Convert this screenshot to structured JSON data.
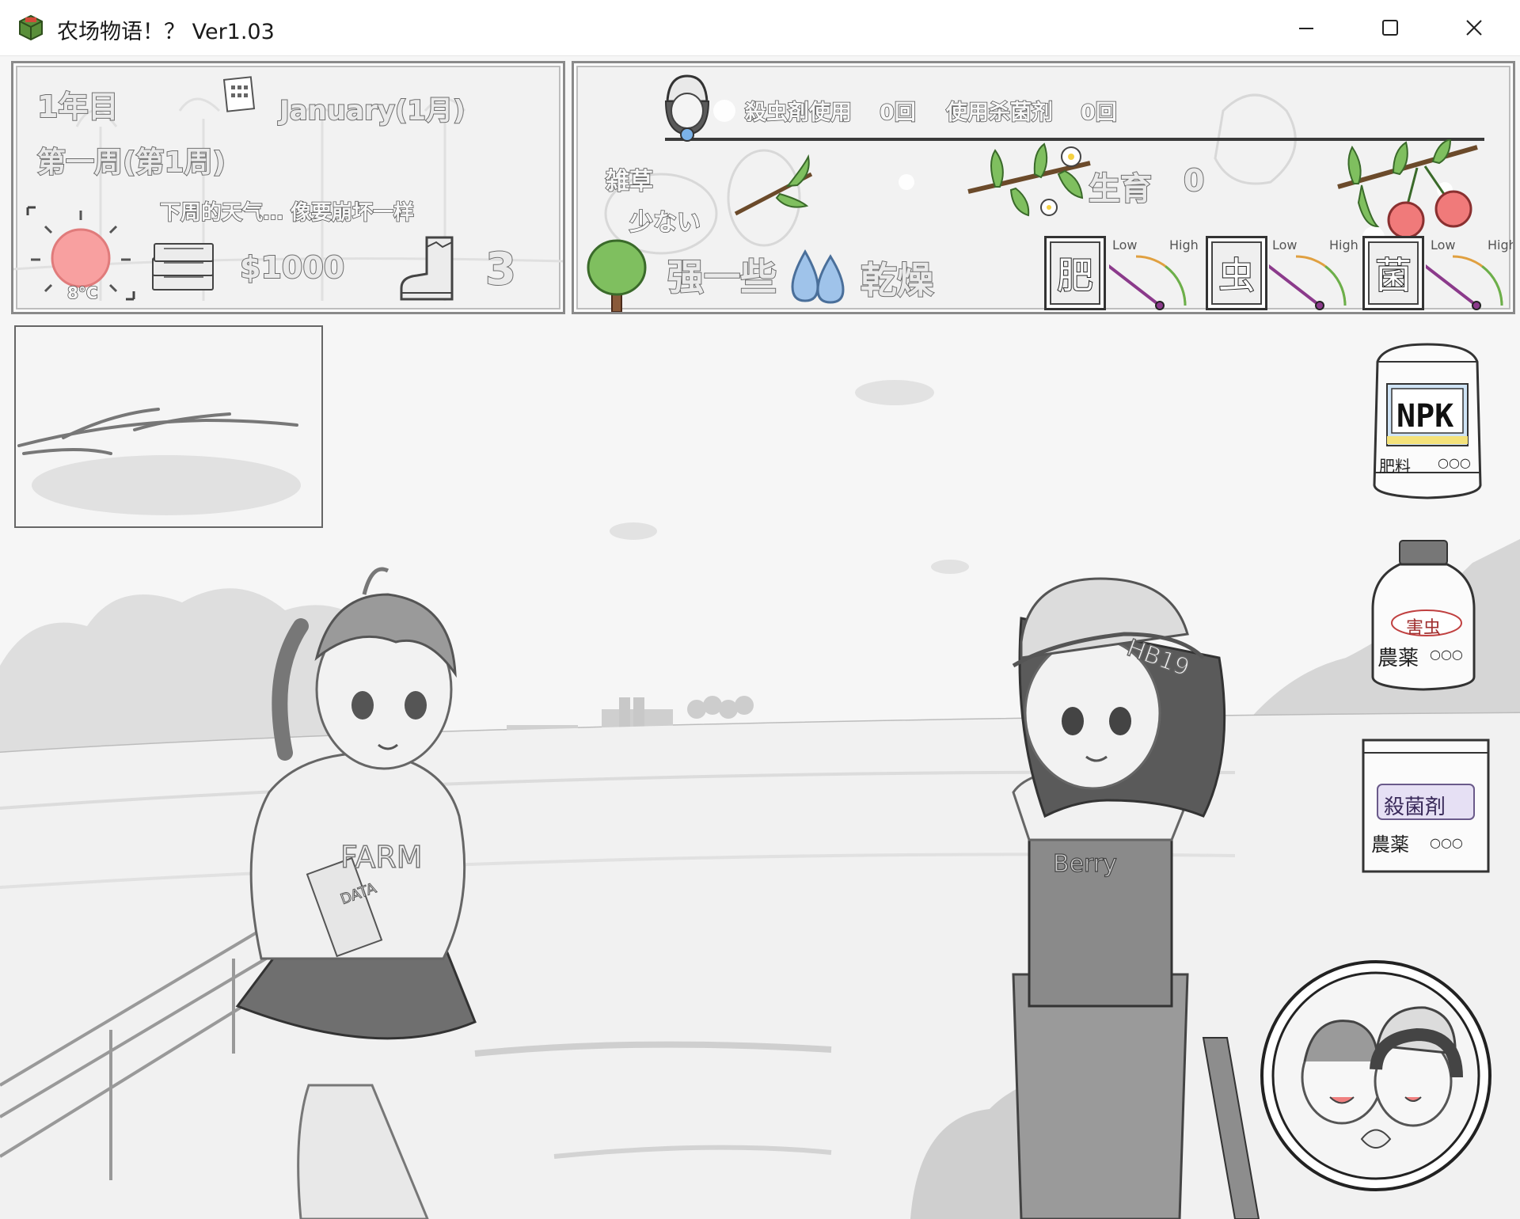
{
  "window": {
    "title": "农场物语！？ Ver1.03",
    "controls": [
      "minimize",
      "maximize",
      "close"
    ]
  },
  "calendar": {
    "year": "1年目",
    "month": "January(1月)",
    "week": "第一周(第1周)",
    "next_week_weather": "下周的天气… 像要崩坏一样",
    "temperature": "8°C",
    "money": "$1000",
    "stamina": "3"
  },
  "crop": {
    "pesticide_used_label": "殺虫剤使用",
    "pesticide_used_value": "0回",
    "fungicide_used_label": "使用杀菌剂",
    "fungicide_used_value": "0回",
    "weed_label": "雑草",
    "weed_value": "少ない",
    "growth_label": "生育",
    "growth_value": "0",
    "tree_strength": "强一些",
    "moisture": "乾燥",
    "gauges": [
      {
        "label": "肥",
        "low": "Low",
        "high": "High",
        "level": 0.15
      },
      {
        "label": "虫",
        "low": "Low",
        "high": "High",
        "level": 0.15
      },
      {
        "label": "菌",
        "low": "Low",
        "high": "High",
        "level": 0.15
      }
    ]
  },
  "items": {
    "fertilizer": {
      "brand": "NPK",
      "label": "肥料",
      "dots": "○○○"
    },
    "pesticide": {
      "tag": "害虫",
      "label": "農薬",
      "dots": "○○○"
    },
    "fungicide": {
      "tag": "殺菌剤",
      "label": "農薬",
      "dots": "○○○"
    }
  },
  "characters": {
    "left_hoodie_text": "FARM",
    "left_book_text": "DATA",
    "right_cap_text": "HB19",
    "right_overalls_text": "Berry"
  },
  "colors": {
    "sun": "#f8a0a0",
    "leaf": "#7fbf5f",
    "cherry": "#f07a7a",
    "water": "#9fc3ea",
    "gauge_needle": "#8b3a8b"
  }
}
